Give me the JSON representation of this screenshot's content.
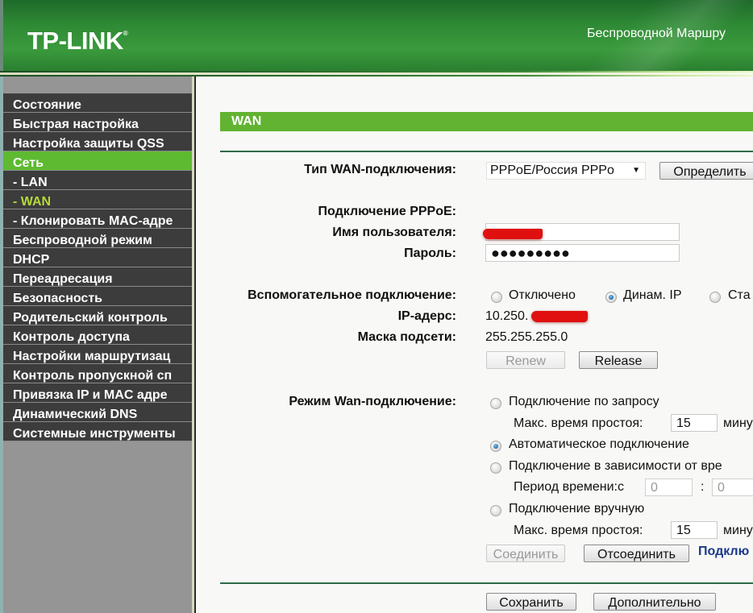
{
  "header": {
    "logo": "TP-LINK",
    "logo_mark": "®",
    "title": "Беспроводной Маршру"
  },
  "sidebar": {
    "items": [
      {
        "label": "Состояние"
      },
      {
        "label": "Быстрая настройка"
      },
      {
        "label": "Настройка защиты QSS"
      },
      {
        "label": "Сеть",
        "state": "active"
      },
      {
        "label": "- LAN"
      },
      {
        "label": "- WAN",
        "state": "current"
      },
      {
        "label": "- Клонировать MAC-адре"
      },
      {
        "label": "Беспроводной режим"
      },
      {
        "label": "DHCP"
      },
      {
        "label": "Переадресация"
      },
      {
        "label": "Безопасность"
      },
      {
        "label": "Родительский контроль"
      },
      {
        "label": "Контроль доступа"
      },
      {
        "label": "Настройки маршрутизац"
      },
      {
        "label": "Контроль пропускной сп"
      },
      {
        "label": "Привязка IP и MAC адре"
      },
      {
        "label": "Динамический DNS"
      },
      {
        "label": "Системные инструменты"
      }
    ]
  },
  "main": {
    "section_title": "WAN",
    "wan_type": {
      "label": "Тип WAN-подключения:",
      "value": "PPPoE/Россия PPPo",
      "detect_button": "Определить"
    },
    "pppoe": {
      "heading": "Подключение PPPoE:",
      "username_label": "Имя пользователя:",
      "username_value": "",
      "password_label": "Пароль:",
      "password_value": "●●●●●●●●●"
    },
    "secondary": {
      "label": "Вспомогательное подключение:",
      "options": [
        {
          "label": "Отключено",
          "checked": false
        },
        {
          "label": "Динам. IP",
          "checked": true
        },
        {
          "label": "Ста",
          "checked": false
        }
      ],
      "ip_label": "IP-адерс:",
      "ip_value": "10.250.",
      "mask_label": "Маска подсети:",
      "mask_value": "255.255.255.0",
      "renew_button": "Renew",
      "release_button": "Release"
    },
    "wan_mode": {
      "label": "Режим Wan-подключение:",
      "on_demand": {
        "label": "Подключение по запросу",
        "checked": false
      },
      "idle_label_1": "Макс. время простоя:",
      "idle_value_1": "15",
      "idle_unit_1": "мину",
      "auto": {
        "label": "Автоматическое подключение",
        "checked": true
      },
      "time_based": {
        "label": "Подключение в зависимости от вре",
        "checked": false
      },
      "period_label": "Период времени:с",
      "period_from": "0",
      "period_sep": ":",
      "period_to": "0",
      "manual": {
        "label": "Подключение вручную",
        "checked": false
      },
      "idle_label_2": "Макс. время простоя:",
      "idle_value_2": "15",
      "idle_unit_2": "мину",
      "connect_button": "Соединить",
      "disconnect_button": "Отсоединить",
      "status_link": "Подклю"
    },
    "save_button": "Сохранить",
    "advanced_button": "Дополнительно"
  }
}
